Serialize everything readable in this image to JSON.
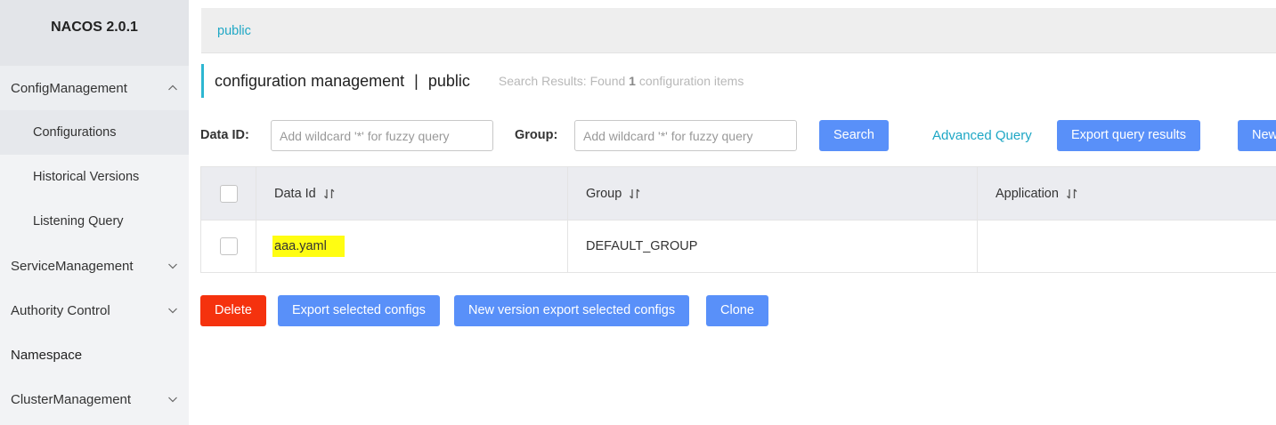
{
  "brand": "NACOS 2.0.1",
  "sidebar": {
    "items": [
      {
        "label": "ConfigManagement",
        "chevron": "up"
      },
      {
        "label": "Configurations"
      },
      {
        "label": "Historical Versions"
      },
      {
        "label": "Listening Query"
      },
      {
        "label": "ServiceManagement",
        "chevron": "down"
      },
      {
        "label": "Authority Control",
        "chevron": "down"
      },
      {
        "label": "Namespace"
      },
      {
        "label": "ClusterManagement",
        "chevron": "down"
      }
    ]
  },
  "namespace_bar": {
    "active": "public"
  },
  "header": {
    "title": "configuration management",
    "separator": "|",
    "namespace": "public",
    "result_prefix": "Search Results: Found",
    "result_count": "1",
    "result_suffix": "configuration items"
  },
  "filters": {
    "data_id_label": "Data ID:",
    "data_id_placeholder": "Add wildcard '*' for fuzzy query",
    "group_label": "Group:",
    "group_placeholder": "Add wildcard '*' for fuzzy query",
    "search_label": "Search",
    "advanced_label": "Advanced Query",
    "export_query_label": "Export query results",
    "new_label": "New"
  },
  "table": {
    "columns": [
      "Data Id",
      "Group",
      "Application"
    ],
    "rows": [
      {
        "data_id": "aaa.yaml",
        "group": "DEFAULT_GROUP",
        "application": ""
      }
    ]
  },
  "actions": {
    "delete_label": "Delete",
    "export_selected_label": "Export selected configs",
    "new_version_export_label": "New version export selected configs",
    "clone_label": "Clone"
  },
  "colors": {
    "primary": "#5990f9",
    "danger": "#f5320e",
    "link": "#1ea7c5",
    "highlight": "#fffd12"
  }
}
